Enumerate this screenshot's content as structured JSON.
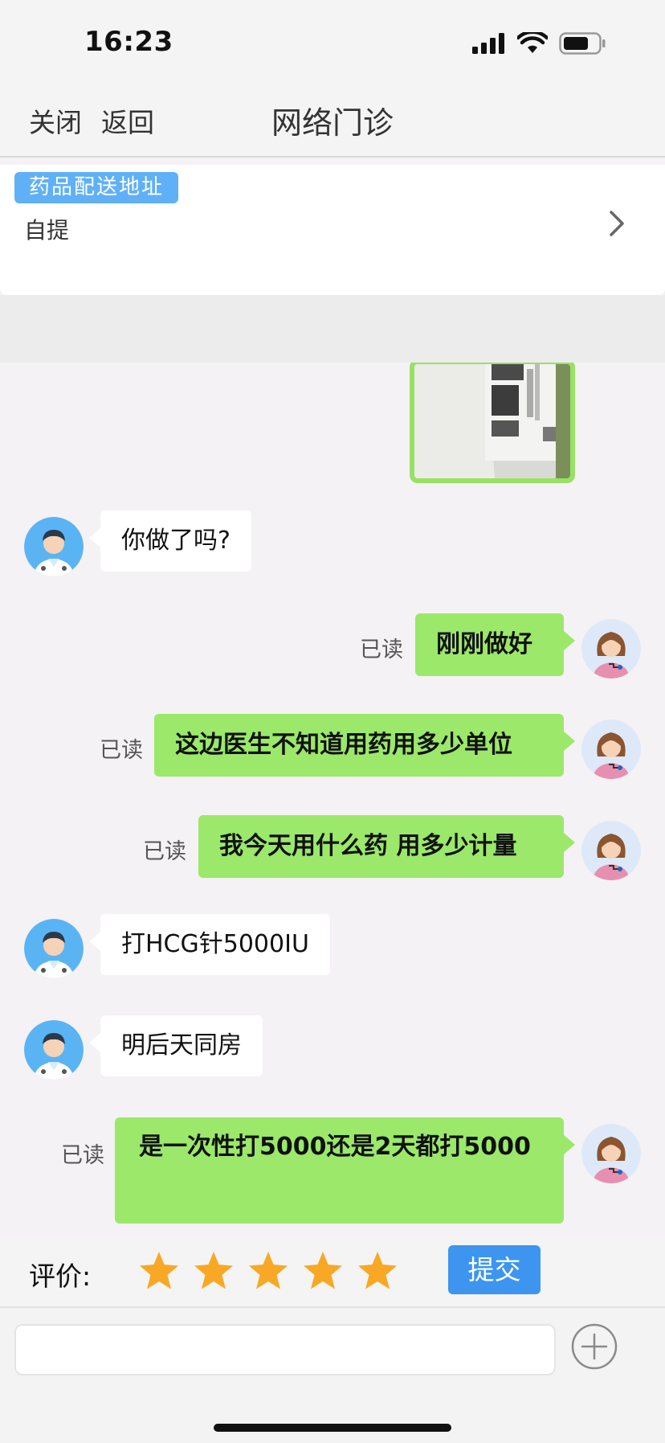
{
  "status_bar": {
    "time": "16:23",
    "icons": [
      "signal-icon",
      "wifi-icon",
      "battery-icon"
    ]
  },
  "nav": {
    "close": "关闭",
    "back": "返回",
    "title": "网络门诊"
  },
  "address": {
    "tag": "药品配送地址",
    "value": "自提"
  },
  "messages": [
    {
      "from": "doctor",
      "text": "你做了吗?"
    },
    {
      "from": "me",
      "text": "刚刚做好",
      "status": "已读"
    },
    {
      "from": "me",
      "text": "这边医生不知道用药用多少单位",
      "status": "已读"
    },
    {
      "from": "me",
      "text": "我今天用什么药 用多少计量",
      "status": "已读"
    },
    {
      "from": "doctor",
      "text": "打HCG针5000IU"
    },
    {
      "from": "doctor",
      "text": "明后天同房"
    },
    {
      "from": "me",
      "text": "是一次性打5000还是2天都打5000",
      "status": "已读"
    }
  ],
  "rating": {
    "label": "评价:",
    "stars": 5,
    "max_stars": 5,
    "submit": "提交",
    "star_color": "#f9a825"
  },
  "input": {
    "placeholder": ""
  },
  "colors": {
    "my_bubble": "#9be86a",
    "tag_blue": "#5fb0f7",
    "submit_blue": "#3d95ef"
  }
}
